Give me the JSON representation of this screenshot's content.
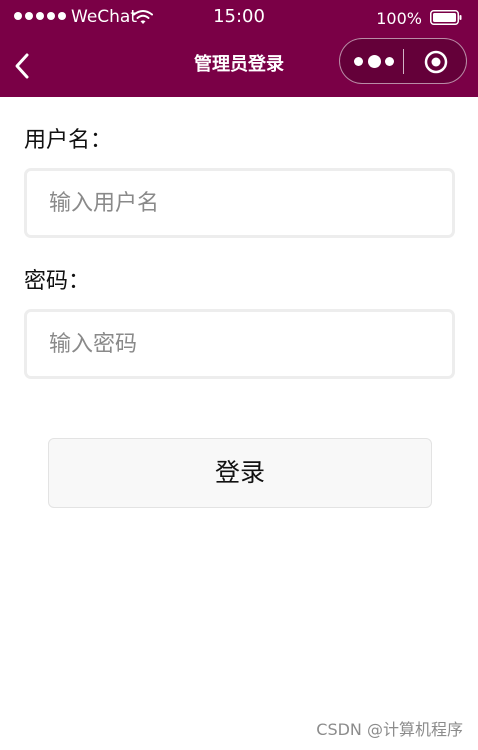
{
  "status_bar": {
    "carrier": "WeChat",
    "time": "15:00",
    "battery": "100%"
  },
  "nav": {
    "title": "管理员登录",
    "back_icon": "back-chevron-icon",
    "menu_icon": "more-dots-icon",
    "close_icon": "close-target-icon"
  },
  "form": {
    "username_label": "用户名：",
    "username_placeholder": "输入用户名",
    "password_label": "密码：",
    "password_placeholder": "输入密码",
    "submit_label": "登录"
  },
  "footer": {
    "watermark": "CSDN @计算机程序"
  },
  "colors": {
    "nav_background": "#7a0046",
    "input_border": "#ededed",
    "button_background": "#f8f8f8"
  }
}
